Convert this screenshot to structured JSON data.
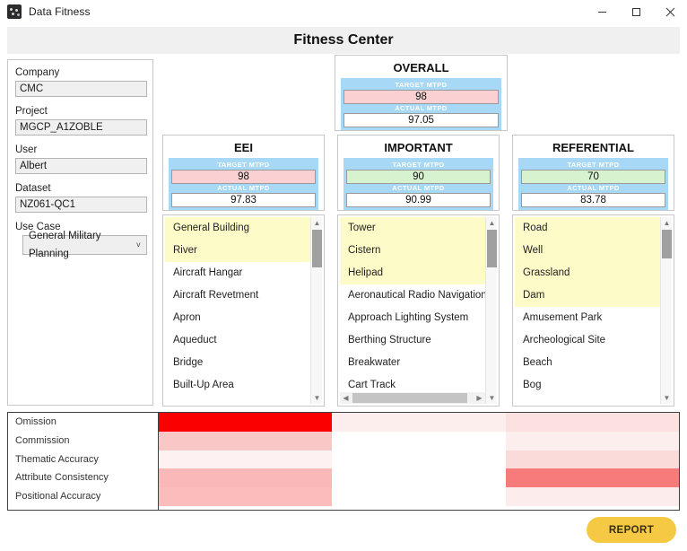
{
  "window": {
    "title": "Data Fitness",
    "icon": "app-icon",
    "controls": {
      "minimize": "minimize-icon",
      "maximize": "maximize-icon",
      "close": "close-icon"
    }
  },
  "header": {
    "title": "Fitness Center"
  },
  "form": {
    "fields": [
      {
        "label": "Company",
        "value": "CMC"
      },
      {
        "label": "Project",
        "value": "MGCP_A1ZOBLE"
      },
      {
        "label": "User",
        "value": "Albert"
      },
      {
        "label": "Dataset",
        "value": "NZ061-QC1"
      }
    ],
    "use_case": {
      "label": "Use Case",
      "value": "General Military Planning",
      "chevron": "˅"
    }
  },
  "overall": {
    "name": "OVERALL",
    "target_caption": "TARGET MTPD",
    "target_value": "98",
    "target_state": "pink",
    "actual_caption": "ACTUAL MTPD",
    "actual_value": "97.05"
  },
  "categories": [
    {
      "name": "EEI",
      "target_caption": "TARGET MTPD",
      "target_value": "98",
      "target_state": "pink",
      "actual_caption": "ACTUAL MTPD",
      "actual_value": "97.83",
      "items": [
        {
          "label": "General Building",
          "highlighted": true
        },
        {
          "label": "River",
          "highlighted": true
        },
        {
          "label": "Aircraft Hangar",
          "highlighted": false
        },
        {
          "label": "Aircraft Revetment",
          "highlighted": false
        },
        {
          "label": "Apron",
          "highlighted": false
        },
        {
          "label": "Aqueduct",
          "highlighted": false
        },
        {
          "label": "Bridge",
          "highlighted": false
        },
        {
          "label": "Built-Up Area",
          "highlighted": false
        }
      ],
      "hscroll": false
    },
    {
      "name": "IMPORTANT",
      "target_caption": "TARGET MTPD",
      "target_value": "90",
      "target_state": "green",
      "actual_caption": "ACTUAL MTPD",
      "actual_value": "90.99",
      "items": [
        {
          "label": "Tower",
          "highlighted": true
        },
        {
          "label": "Cistern",
          "highlighted": true
        },
        {
          "label": "Helipad",
          "highlighted": true
        },
        {
          "label": "Aeronautical Radio Navigation Service",
          "highlighted": false
        },
        {
          "label": "Approach Lighting System",
          "highlighted": false
        },
        {
          "label": "Berthing Structure",
          "highlighted": false
        },
        {
          "label": "Breakwater",
          "highlighted": false
        },
        {
          "label": "Cart Track",
          "highlighted": false
        }
      ],
      "hscroll": true
    },
    {
      "name": "REFERENTIAL",
      "target_caption": "TARGET MTPD",
      "target_value": "70",
      "target_state": "green",
      "actual_caption": "ACTUAL MTPD",
      "actual_value": "83.78",
      "items": [
        {
          "label": "Road",
          "highlighted": true
        },
        {
          "label": "Well",
          "highlighted": true
        },
        {
          "label": "Grassland",
          "highlighted": true
        },
        {
          "label": "Dam",
          "highlighted": true
        },
        {
          "label": "Amusement Park",
          "highlighted": false
        },
        {
          "label": "Archeological Site",
          "highlighted": false
        },
        {
          "label": "Beach",
          "highlighted": false
        },
        {
          "label": "Bog",
          "highlighted": false
        }
      ],
      "hscroll": false
    }
  ],
  "heatmap": {
    "rows": [
      "Omission",
      "Commission",
      "Thematic Accuracy",
      "Attribute Consistency",
      "Positional Accuracy"
    ],
    "columns": [
      "EEI",
      "IMPORTANT",
      "REFERENTIAL"
    ],
    "colors": [
      [
        "#fb0000",
        "#fdeeee",
        "#fce1e1"
      ],
      [
        "#fac7c7",
        "#ffffff",
        "#fdeeee"
      ],
      [
        "#fdf1f1",
        "#ffffff",
        "#fbdada"
      ],
      [
        "#fab8b8",
        "#ffffff",
        "#f87b7b"
      ],
      [
        "#fbbcbc",
        "#ffffff",
        "#fdecec"
      ]
    ]
  },
  "footer": {
    "report_label": "REPORT",
    "report_color": "#f6c945"
  }
}
